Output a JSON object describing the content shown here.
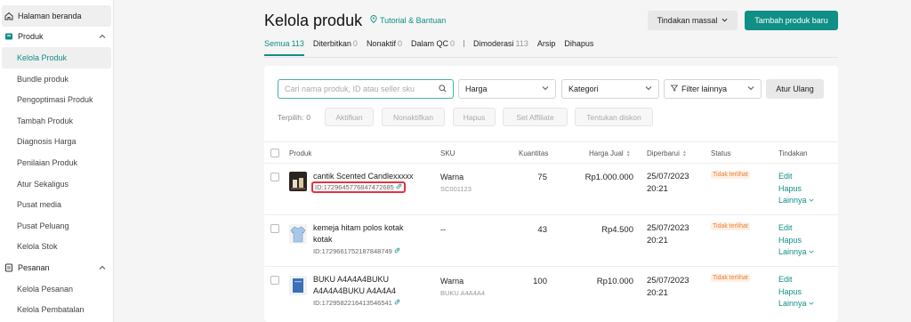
{
  "sidebar": {
    "home": "Halaman beranda",
    "produk": {
      "label": "Produk",
      "items": [
        "Kelola Produk",
        "Bundle produk",
        "Pengoptimasi Produk",
        "Tambah Produk",
        "Diagnosis Harga",
        "Penilaian Produk",
        "Atur Sekaligus",
        "Pusat media",
        "Pusat Peluang",
        "Kelola Stok"
      ]
    },
    "pesanan": {
      "label": "Pesanan",
      "items": [
        "Kelola Pesanan",
        "Kelola Pembatalan"
      ]
    }
  },
  "header": {
    "title": "Kelola produk",
    "tutorial": "Tutorial & Bantuan",
    "bulk_action": "Tindakan massal",
    "add_product": "Tambah produk baru"
  },
  "tabs": [
    {
      "label": "Semua",
      "count": "113"
    },
    {
      "label": "Diterbitkan",
      "count": "0"
    },
    {
      "label": "Nonaktif",
      "count": "0"
    },
    {
      "label": "Dalam QC",
      "count": "0"
    },
    {
      "label": "Dimoderasi",
      "count": "113"
    },
    {
      "label": "Arsip",
      "count": ""
    },
    {
      "label": "Dihapus",
      "count": ""
    }
  ],
  "filters": {
    "search_placeholder": "Cari nama produk, ID atau seller sku",
    "price": "Harga",
    "category": "Kategori",
    "more_filters": "Filter lainnya",
    "reset": "Atur Ulang"
  },
  "selection": {
    "label": "Terpilih:",
    "count": "0",
    "buttons": [
      "Aktifkan",
      "Nonaktifkan",
      "Hapus",
      "Set Affiliate",
      "Tentukan diskon"
    ]
  },
  "table": {
    "headers": {
      "product": "Produk",
      "sku": "SKU",
      "quantity": "Kuantitas",
      "price": "Harga Jual",
      "updated": "Diperbarui",
      "status": "Status",
      "actions": "Tindakan"
    },
    "rows": [
      {
        "name": "cantik Scented Candlexxxxx",
        "id": "ID:1729645776847472685",
        "sku_name": "Warna",
        "sku_code": "SC001123",
        "quantity": "75",
        "price": "Rp1.000.000",
        "date": "25/07/2023",
        "time": "20:21",
        "status": "Tidak terlihat",
        "highlight": true
      },
      {
        "name": "kemeja hitam polos kotak kotak",
        "id": "ID:1729661752187848749",
        "sku_name": "--",
        "sku_code": "",
        "quantity": "43",
        "price": "Rp4.500",
        "date": "25/07/2023",
        "time": "20:21",
        "status": "Tidak terlihat",
        "highlight": false
      },
      {
        "name": "BUKU A4A4A4BUKU A4A4A4BUKU A4A4A4",
        "id": "ID:1729582216413546541",
        "sku_name": "Warna",
        "sku_code": "BUKU A4A4A4",
        "quantity": "100",
        "price": "Rp10.000",
        "date": "25/07/2023",
        "time": "20:21",
        "status": "Tidak terlihat",
        "highlight": false
      }
    ],
    "action_labels": {
      "edit": "Edit",
      "delete": "Hapus",
      "more": "Lainnya"
    }
  },
  "colors": {
    "accent": "#0f8f85",
    "status": "#e8833a",
    "highlight": "#e0343f"
  }
}
